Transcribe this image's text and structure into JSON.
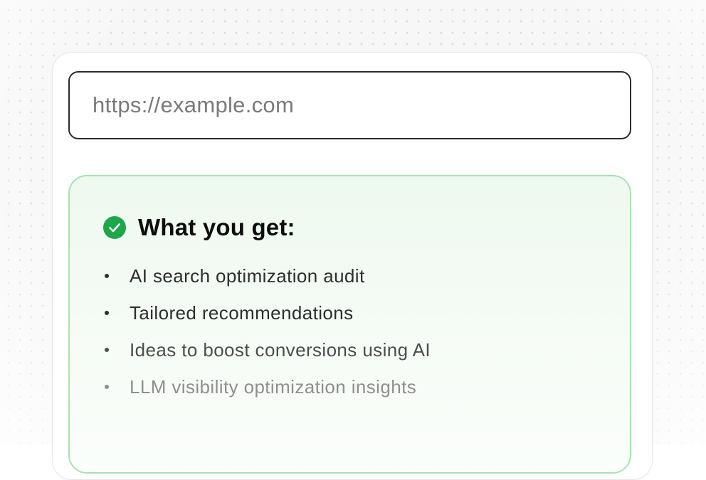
{
  "url_field": {
    "placeholder": "https://example.com",
    "value": ""
  },
  "benefits": {
    "icon": "check-circle-icon",
    "title": "What you get:",
    "items": [
      "AI search optimization audit",
      "Tailored recommendations",
      "Ideas to boost conversions using AI",
      "LLM visibility optimization insights"
    ]
  },
  "colors": {
    "accent_green": "#1fa64a",
    "box_border": "#a9e2b1",
    "box_background": "#eef9ef",
    "input_border": "#2b2b2b"
  }
}
